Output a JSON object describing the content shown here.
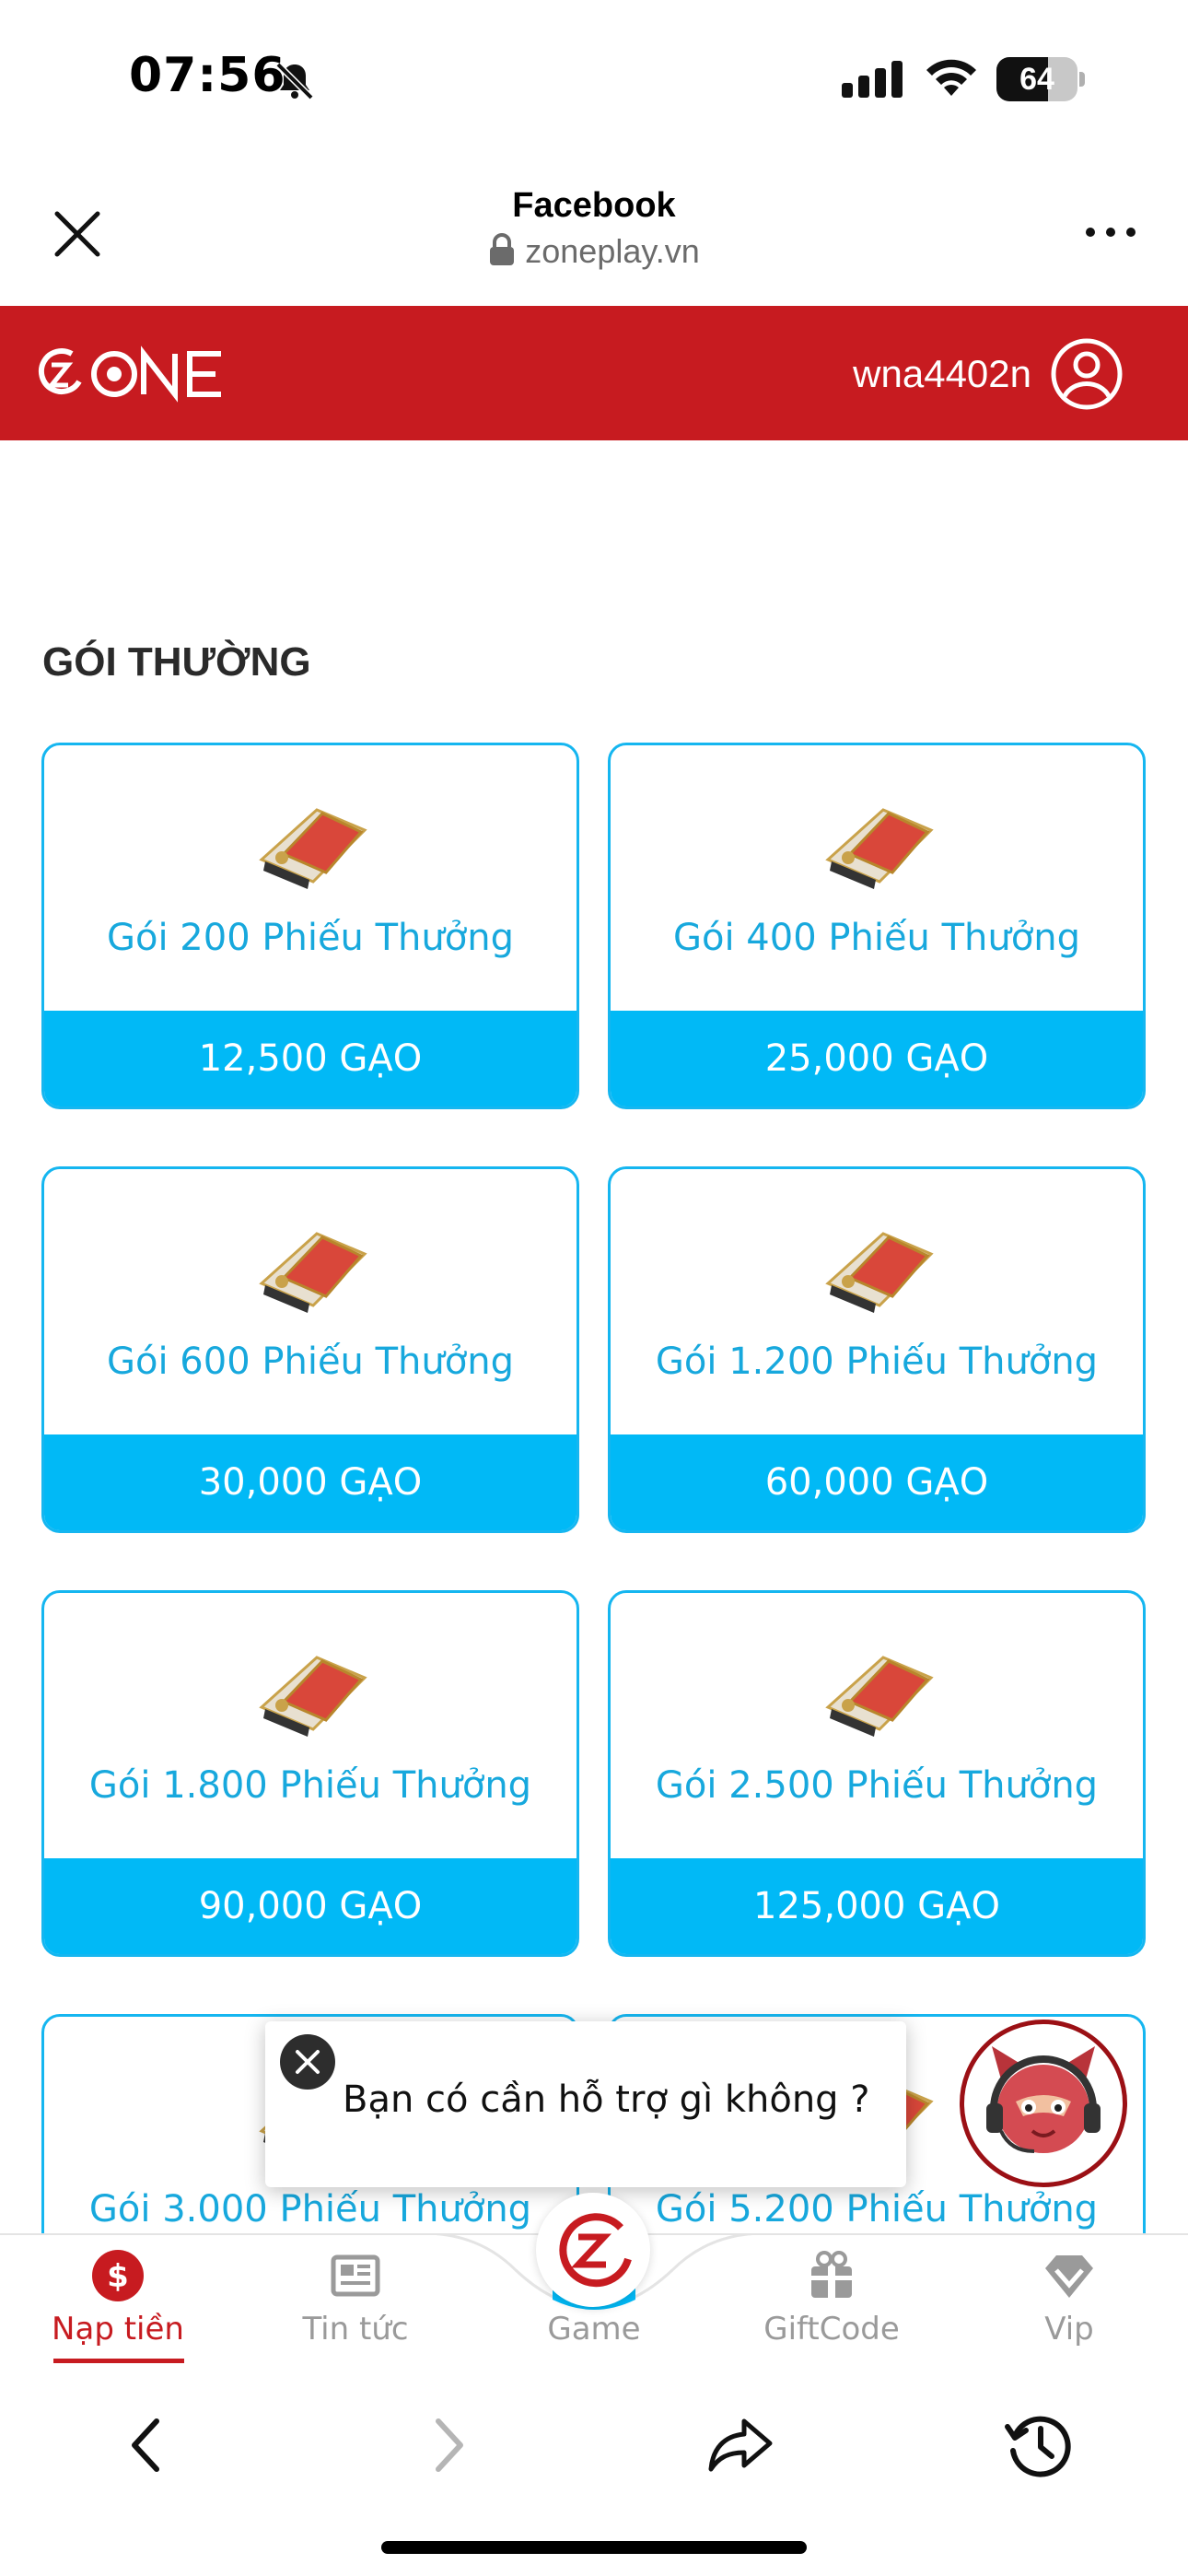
{
  "status_bar": {
    "time": "07:56",
    "battery": "64",
    "battery_level": 0.64,
    "icons": [
      "bell-slash-icon",
      "cellular-signal-icon",
      "wifi-icon",
      "battery-icon"
    ]
  },
  "browser": {
    "title": "Facebook",
    "url": "zoneplay.vn",
    "icons": [
      "close-icon",
      "lock-icon",
      "more-icon"
    ]
  },
  "site_header": {
    "logo_text": "ZONE",
    "username": "wna4402n",
    "brand_color": "#c71b20"
  },
  "section": {
    "title": "GÓI THƯỜNG"
  },
  "packages": [
    {
      "name": "Gói 200 Phiếu Thưởng",
      "price": "12,500 GẠO"
    },
    {
      "name": "Gói 400 Phiếu Thưởng",
      "price": "25,000 GẠO"
    },
    {
      "name": "Gói 600 Phiếu Thưởng",
      "price": "30,000 GẠO"
    },
    {
      "name": "Gói 1.200 Phiếu Thưởng",
      "price": "60,000 GẠO"
    },
    {
      "name": "Gói 1.800 Phiếu Thưởng",
      "price": "90,000 GẠO"
    },
    {
      "name": "Gói 2.500 Phiếu Thưởng",
      "price": "125,000 GẠO"
    },
    {
      "name": "Gói 3.000 Phiếu Thưởng",
      "price": ""
    },
    {
      "name": "Gói 5.200 Phiếu Thưởng",
      "price": ""
    }
  ],
  "chat": {
    "message": "Bạn có cần hỗ trợ gì không ?"
  },
  "bottom_nav": {
    "items": [
      {
        "label": "Nạp tiền",
        "icon": "dollar-icon",
        "active": true
      },
      {
        "label": "Tin tức",
        "icon": "news-icon",
        "active": false
      },
      {
        "label": "Game",
        "icon": "zone-logo-icon",
        "active": false
      },
      {
        "label": "GiftCode",
        "icon": "gift-icon",
        "active": false
      },
      {
        "label": "Vip",
        "icon": "diamond-icon",
        "active": false
      }
    ]
  },
  "browser_bar": {
    "icons": [
      "back-arrow-icon",
      "forward-arrow-icon",
      "share-icon",
      "history-icon"
    ]
  },
  "colors": {
    "accent_blue": "#01b9f6",
    "card_border": "#15b6f0",
    "package_text": "#17a8dd",
    "brand_red": "#c71b20"
  }
}
